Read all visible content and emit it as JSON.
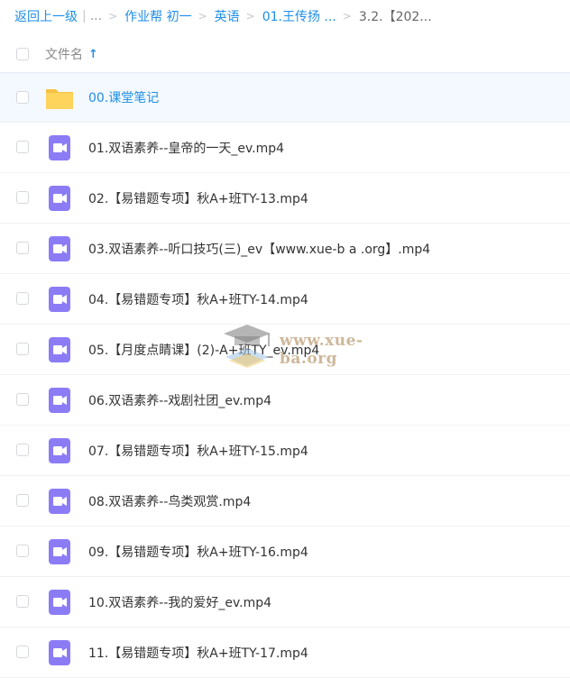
{
  "breadcrumb": {
    "back": "返回上一级",
    "ellipsis": "...",
    "items": [
      "作业帮 初一",
      "英语",
      "01.王传扬 ..."
    ],
    "current": "3.2.【202..."
  },
  "header": {
    "column_name": "文件名",
    "sort_arrow": "↑"
  },
  "files": [
    {
      "name": "00.课堂笔记",
      "type": "folder-icon"
    },
    {
      "name": "01.双语素养--皇帝的一天_ev.mp4",
      "type": "video-icon"
    },
    {
      "name": "02.【易错题专项】秋A+班TY-13.mp4",
      "type": "video-icon"
    },
    {
      "name": "03.双语素养--听口技巧(三)_ev【www.xue-b a .org】.mp4",
      "type": "video-icon"
    },
    {
      "name": "04.【易错题专项】秋A+班TY-14.mp4",
      "type": "video-icon"
    },
    {
      "name": "05.【月度点睛课】(2)-A+班TY_ev.mp4",
      "type": "video-icon"
    },
    {
      "name": "06.双语素养--戏剧社团_ev.mp4",
      "type": "video-icon"
    },
    {
      "name": "07.【易错题专项】秋A+班TY-15.mp4",
      "type": "video-icon"
    },
    {
      "name": "08.双语素养--鸟类观赏.mp4",
      "type": "video-icon"
    },
    {
      "name": "09.【易错题专项】秋A+班TY-16.mp4",
      "type": "video-icon"
    },
    {
      "name": "10.双语素养--我的爱好_ev.mp4",
      "type": "video-icon"
    },
    {
      "name": "11.【易错题专项】秋A+班TY-17.mp4",
      "type": "video-icon"
    }
  ],
  "watermark": {
    "text": "www.xue-ba.org"
  },
  "colors": {
    "accent": "#1e8ee8",
    "video_icon": "#8b7cf6",
    "folder_icon": "#ffd45c"
  }
}
